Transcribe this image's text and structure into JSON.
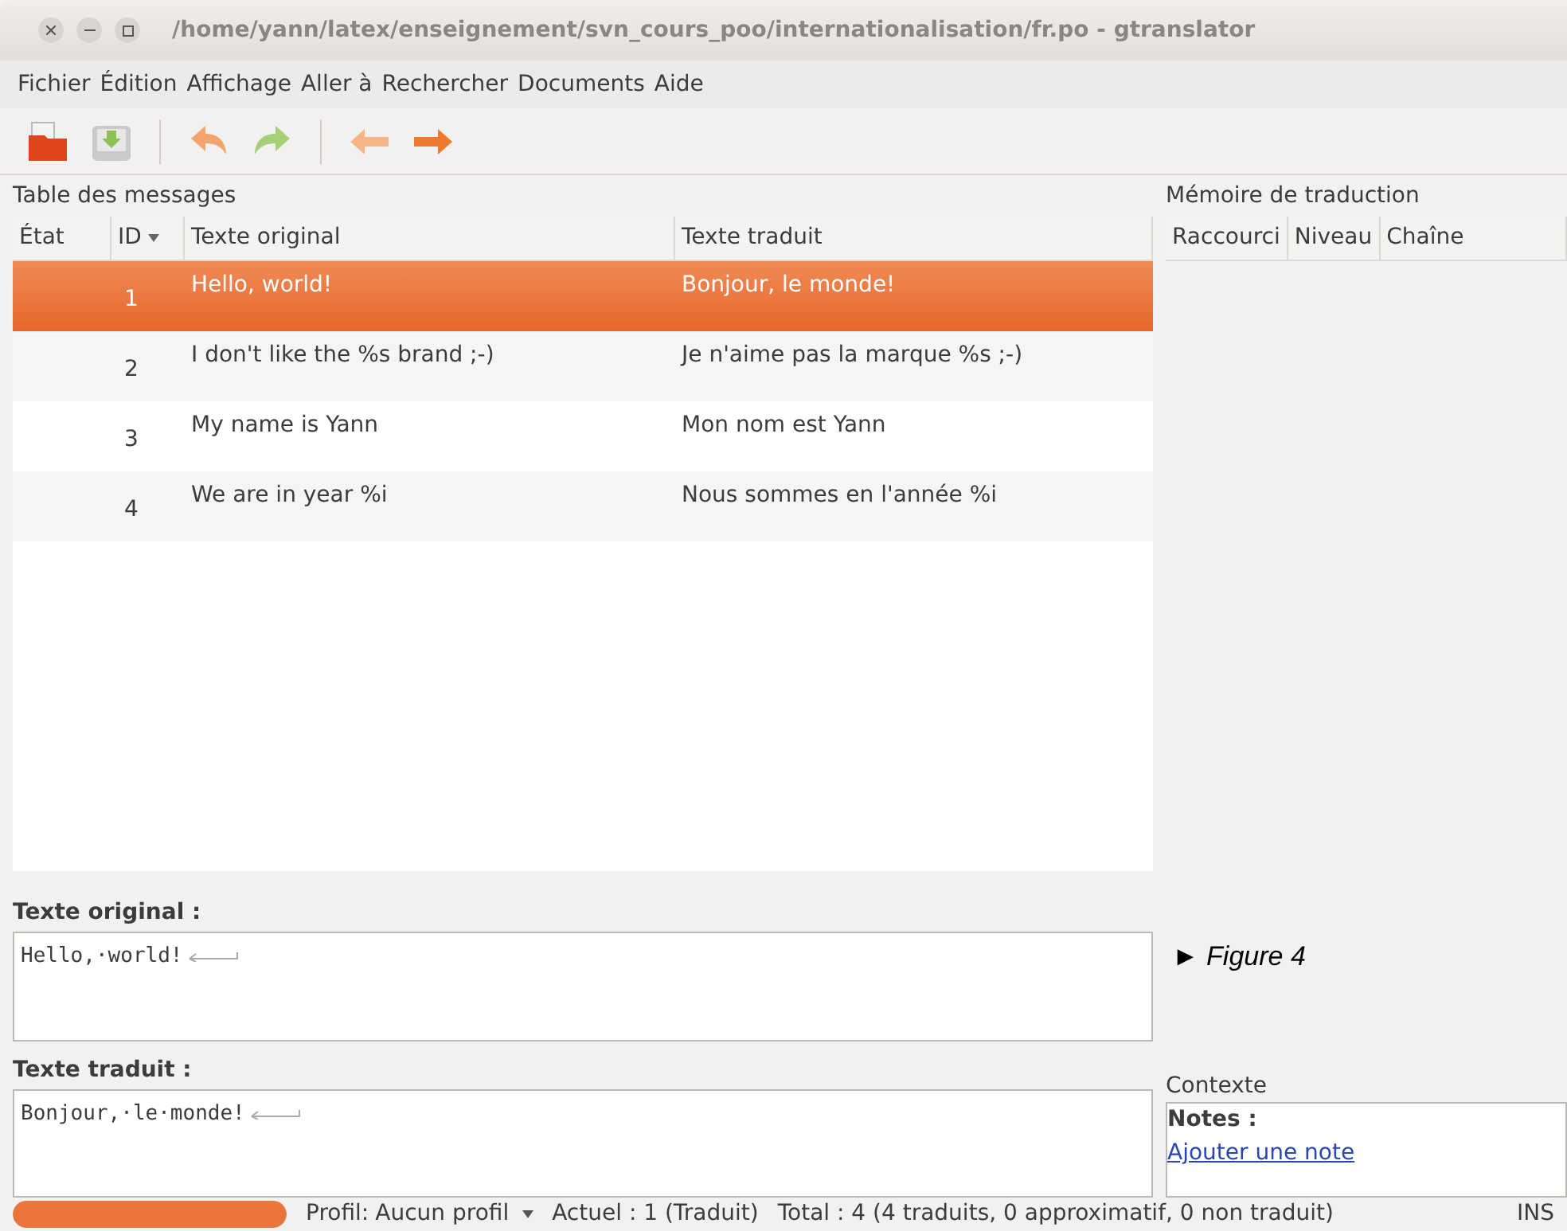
{
  "window": {
    "title": "/home/yann/latex/enseignement/svn_cours_poo/internationalisation/fr.po - gtranslator"
  },
  "menu": [
    "Fichier",
    "Édition",
    "Affichage",
    "Aller à",
    "Rechercher",
    "Documents",
    "Aide"
  ],
  "messages": {
    "title": "Table des messages",
    "columns": [
      "État",
      "ID",
      "Texte original",
      "Texte traduit"
    ],
    "rows": [
      {
        "id": "1",
        "original": "Hello, world!",
        "translated": "Bonjour, le monde!",
        "selected": true
      },
      {
        "id": "2",
        "original": "I don't like the %s brand ;-)",
        "translated": "Je n'aime pas la marque %s ;-)",
        "selected": false
      },
      {
        "id": "3",
        "original": "My name is Yann",
        "translated": "Mon nom est Yann",
        "selected": false
      },
      {
        "id": "4",
        "original": "We are in year %i",
        "translated": "Nous sommes en l'année %i",
        "selected": false
      }
    ]
  },
  "memory": {
    "title": "Mémoire de traduction",
    "columns": [
      "Raccourci",
      "Niveau",
      "Chaîne"
    ]
  },
  "original": {
    "label": "Texte original :",
    "value": "Hello,·world!"
  },
  "translated": {
    "label": "Texte traduit :",
    "value": "Bonjour,·le·monde!"
  },
  "caption": "► Figure 4",
  "context": {
    "title": "Contexte",
    "notes_label": "Notes :",
    "link": "Ajouter une note"
  },
  "status_bar": {
    "level": 1,
    "profile_label": "Profil:",
    "profile": "Aucun profil",
    "current": "Actuel : 1 (Traduit)",
    "total": "Total : 4 (4 traduits, 0 approximatif, 0 non traduit)",
    "mode": "INS"
  }
}
